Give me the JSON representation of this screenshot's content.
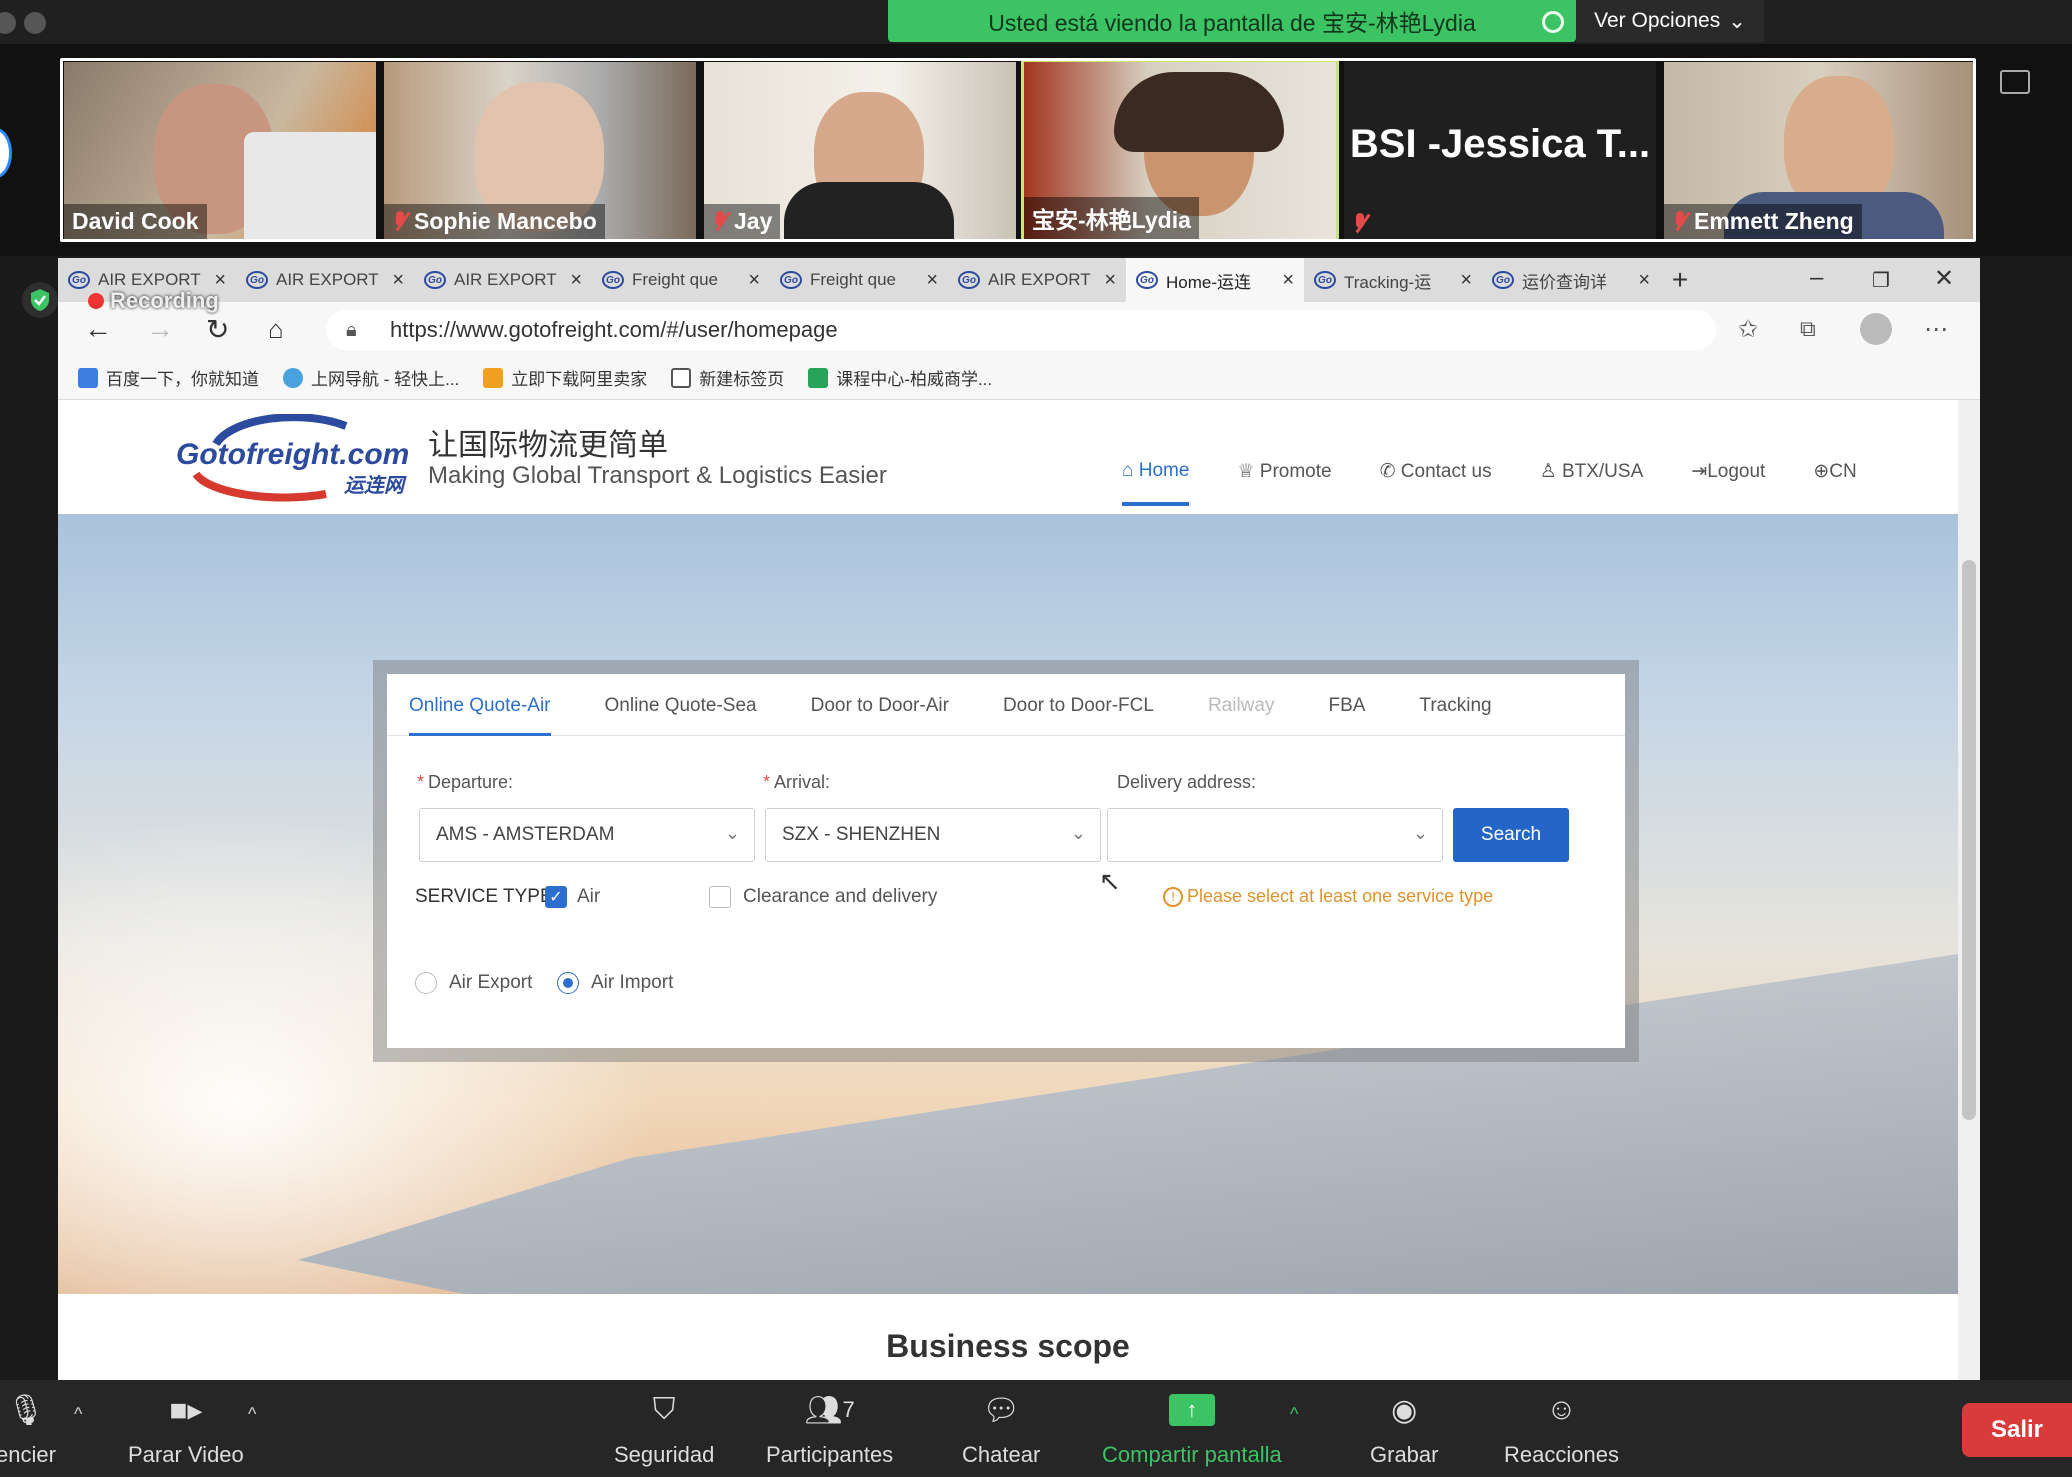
{
  "zoom": {
    "banner_text": "Usted está viendo la pantalla de 宝安-林艳Lydia",
    "view_options": "Ver Opciones",
    "recording": "Recording",
    "participants": [
      {
        "name": "David Cook",
        "muted": false
      },
      {
        "name": "Sophie Mancebo",
        "muted": true
      },
      {
        "name": "Jay",
        "muted": true
      },
      {
        "name": "宝安-林艳Lydia",
        "muted": false
      },
      {
        "name": "BSI -Jessica T...",
        "muted": true
      },
      {
        "name": "Emmett Zheng",
        "muted": true
      }
    ],
    "controls": {
      "audio": "encier",
      "video": "Parar Video",
      "security": "Seguridad",
      "participants": "Participantes",
      "participants_count": "7",
      "chat": "Chatear",
      "share": "Compartir pantalla",
      "record": "Grabar",
      "reactions": "Reacciones",
      "leave": "Salir"
    }
  },
  "browser": {
    "tabs": [
      {
        "title": "AIR EXPORT",
        "active": false
      },
      {
        "title": "AIR EXPORT",
        "active": false
      },
      {
        "title": "AIR EXPORT",
        "active": false
      },
      {
        "title": "Freight que",
        "active": false
      },
      {
        "title": "Freight que",
        "active": false
      },
      {
        "title": "AIR EXPORT",
        "active": false
      },
      {
        "title": "Home-运连",
        "active": true
      },
      {
        "title": "Tracking-运",
        "active": false
      },
      {
        "title": "运价查询详",
        "active": false
      }
    ],
    "url": "https://www.gotofreight.com/#/user/homepage",
    "bookmarks": [
      {
        "label": "百度一下，你就知道",
        "color": "#3d7fe0"
      },
      {
        "label": "上网导航 - 轻快上...",
        "color": "#4aa3df"
      },
      {
        "label": "立即下载阿里卖家",
        "color": "#f0a020"
      },
      {
        "label": "新建标签页",
        "color": "#555555"
      },
      {
        "label": "课程中心-柏威商学...",
        "color": "#27a35a"
      }
    ]
  },
  "site": {
    "logo_text": "Gotofreight.com",
    "logo_cn": "运连网",
    "slogan_cn": "让国际物流更简单",
    "slogan_en": "Making Global Transport & Logistics Easier",
    "nav": [
      {
        "label": "Home",
        "icon": "home-icon",
        "glyph": "⌂",
        "active": true
      },
      {
        "label": "Promote",
        "icon": "trophy-icon",
        "glyph": "♕",
        "active": false
      },
      {
        "label": "Contact us",
        "icon": "phone-icon",
        "glyph": "✆",
        "active": false
      },
      {
        "label": "BTX/USA",
        "icon": "user-icon",
        "glyph": "♙",
        "active": false
      },
      {
        "label": "Logout",
        "icon": "logout-icon",
        "glyph": "⇥",
        "active": false
      },
      {
        "label": "CN",
        "icon": "globe-icon",
        "glyph": "⊕",
        "active": false
      }
    ],
    "quote_tabs": [
      {
        "label": "Online Quote-Air",
        "state": "active"
      },
      {
        "label": "Online Quote-Sea",
        "state": "normal"
      },
      {
        "label": "Door to Door-Air",
        "state": "normal"
      },
      {
        "label": "Door to Door-FCL",
        "state": "normal"
      },
      {
        "label": "Railway",
        "state": "disabled"
      },
      {
        "label": "FBA",
        "state": "normal"
      },
      {
        "label": "Tracking",
        "state": "normal"
      }
    ],
    "form": {
      "departure_label": "Departure:",
      "departure_value": "AMS - AMSTERDAM",
      "arrival_label": "Arrival:",
      "arrival_value": "SZX - SHENZHEN",
      "delivery_label": "Delivery address:",
      "delivery_value": "",
      "search_button": "Search",
      "service_type_label": "SERVICE TYPE:",
      "service_air": "Air",
      "service_air_checked": true,
      "service_clearance": "Clearance and delivery",
      "service_clearance_checked": false,
      "warning": "Please select at least one service type",
      "radio_export": "Air Export",
      "radio_import": "Air Import",
      "radio_selected": "Air Import"
    },
    "business_scope": "Business scope"
  }
}
